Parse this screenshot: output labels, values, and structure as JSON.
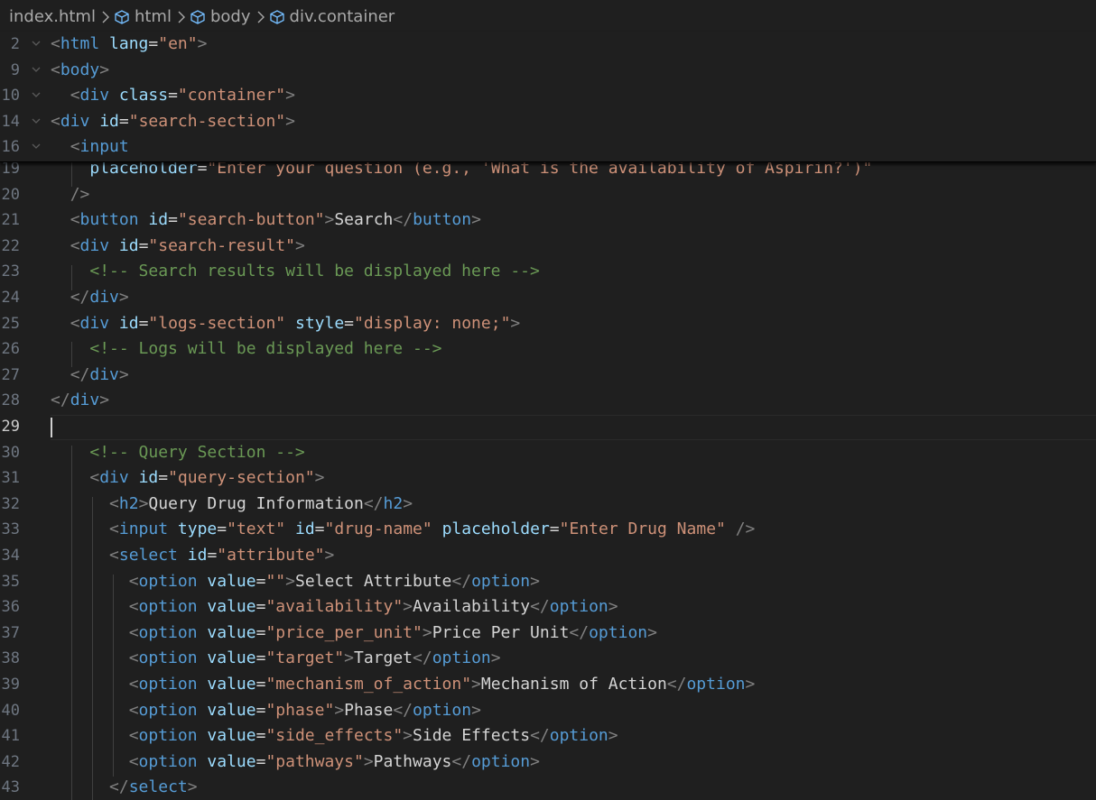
{
  "breadcrumb": {
    "file": "index.html",
    "items": [
      "html",
      "body",
      "div.container"
    ]
  },
  "sticky_lines": [
    {
      "num": "2",
      "parts": [
        [
          "tg",
          "<"
        ],
        [
          "tn",
          "html"
        ],
        [
          "tx",
          " "
        ],
        [
          "an",
          "lang"
        ],
        [
          "tx",
          "="
        ],
        [
          "av",
          "\"en\""
        ],
        [
          "tg",
          ">"
        ]
      ]
    },
    {
      "num": "9",
      "parts": [
        [
          "tg",
          "<"
        ],
        [
          "tn",
          "body"
        ],
        [
          "tg",
          ">"
        ]
      ]
    },
    {
      "num": "10",
      "parts": [
        [
          "tx",
          "  "
        ],
        [
          "tg",
          "<"
        ],
        [
          "tn",
          "div"
        ],
        [
          "tx",
          " "
        ],
        [
          "an",
          "class"
        ],
        [
          "tx",
          "="
        ],
        [
          "av",
          "\"container\""
        ],
        [
          "tg",
          ">"
        ]
      ]
    },
    {
      "num": "14",
      "parts": [
        [
          "tg",
          "<"
        ],
        [
          "tn",
          "div"
        ],
        [
          "tx",
          " "
        ],
        [
          "an",
          "id"
        ],
        [
          "tx",
          "="
        ],
        [
          "av",
          "\"search-section\""
        ],
        [
          "tg",
          ">"
        ]
      ]
    },
    {
      "num": "16",
      "parts": [
        [
          "tx",
          "  "
        ],
        [
          "tg",
          "<"
        ],
        [
          "tn",
          "input"
        ]
      ]
    }
  ],
  "lines": [
    {
      "num": "19",
      "parts": [
        [
          "tx",
          "    "
        ],
        [
          "an",
          "placeholder"
        ],
        [
          "tx",
          "="
        ],
        [
          "av",
          "\"Enter your question (e.g., 'What is the availability of Aspirin?')\""
        ]
      ]
    },
    {
      "num": "20",
      "parts": [
        [
          "tx",
          "  "
        ],
        [
          "tg",
          "/>"
        ]
      ]
    },
    {
      "num": "21",
      "parts": [
        [
          "tx",
          "  "
        ],
        [
          "tg",
          "<"
        ],
        [
          "tn",
          "button"
        ],
        [
          "tx",
          " "
        ],
        [
          "an",
          "id"
        ],
        [
          "tx",
          "="
        ],
        [
          "av",
          "\"search-button\""
        ],
        [
          "tg",
          ">"
        ],
        [
          "tx",
          "Search"
        ],
        [
          "tg",
          "</"
        ],
        [
          "tn",
          "button"
        ],
        [
          "tg",
          ">"
        ]
      ]
    },
    {
      "num": "22",
      "parts": [
        [
          "tx",
          "  "
        ],
        [
          "tg",
          "<"
        ],
        [
          "tn",
          "div"
        ],
        [
          "tx",
          " "
        ],
        [
          "an",
          "id"
        ],
        [
          "tx",
          "="
        ],
        [
          "av",
          "\"search-result\""
        ],
        [
          "tg",
          ">"
        ]
      ]
    },
    {
      "num": "23",
      "parts": [
        [
          "tx",
          "    "
        ],
        [
          "cm",
          "<!-- Search results will be displayed here -->"
        ]
      ]
    },
    {
      "num": "24",
      "parts": [
        [
          "tx",
          "  "
        ],
        [
          "tg",
          "</"
        ],
        [
          "tn",
          "div"
        ],
        [
          "tg",
          ">"
        ]
      ]
    },
    {
      "num": "25",
      "parts": [
        [
          "tx",
          "  "
        ],
        [
          "tg",
          "<"
        ],
        [
          "tn",
          "div"
        ],
        [
          "tx",
          " "
        ],
        [
          "an",
          "id"
        ],
        [
          "tx",
          "="
        ],
        [
          "av",
          "\"logs-section\""
        ],
        [
          "tx",
          " "
        ],
        [
          "an",
          "style"
        ],
        [
          "tx",
          "="
        ],
        [
          "av",
          "\"display: none;\""
        ],
        [
          "tg",
          ">"
        ]
      ]
    },
    {
      "num": "26",
      "parts": [
        [
          "tx",
          "    "
        ],
        [
          "cm",
          "<!-- Logs will be displayed here -->"
        ]
      ]
    },
    {
      "num": "27",
      "parts": [
        [
          "tx",
          "  "
        ],
        [
          "tg",
          "</"
        ],
        [
          "tn",
          "div"
        ],
        [
          "tg",
          ">"
        ]
      ]
    },
    {
      "num": "28",
      "parts": [
        [
          "tg",
          "</"
        ],
        [
          "tn",
          "div"
        ],
        [
          "tg",
          ">"
        ]
      ]
    },
    {
      "num": "29",
      "parts": []
    },
    {
      "num": "30",
      "parts": [
        [
          "tx",
          "    "
        ],
        [
          "cm",
          "<!-- Query Section -->"
        ]
      ]
    },
    {
      "num": "31",
      "parts": [
        [
          "tx",
          "    "
        ],
        [
          "tg",
          "<"
        ],
        [
          "tn",
          "div"
        ],
        [
          "tx",
          " "
        ],
        [
          "an",
          "id"
        ],
        [
          "tx",
          "="
        ],
        [
          "av",
          "\"query-section\""
        ],
        [
          "tg",
          ">"
        ]
      ]
    },
    {
      "num": "32",
      "parts": [
        [
          "tx",
          "      "
        ],
        [
          "tg",
          "<"
        ],
        [
          "tn",
          "h2"
        ],
        [
          "tg",
          ">"
        ],
        [
          "tx",
          "Query Drug Information"
        ],
        [
          "tg",
          "</"
        ],
        [
          "tn",
          "h2"
        ],
        [
          "tg",
          ">"
        ]
      ]
    },
    {
      "num": "33",
      "parts": [
        [
          "tx",
          "      "
        ],
        [
          "tg",
          "<"
        ],
        [
          "tn",
          "input"
        ],
        [
          "tx",
          " "
        ],
        [
          "an",
          "type"
        ],
        [
          "tx",
          "="
        ],
        [
          "av",
          "\"text\""
        ],
        [
          "tx",
          " "
        ],
        [
          "an",
          "id"
        ],
        [
          "tx",
          "="
        ],
        [
          "av",
          "\"drug-name\""
        ],
        [
          "tx",
          " "
        ],
        [
          "an",
          "placeholder"
        ],
        [
          "tx",
          "="
        ],
        [
          "av",
          "\"Enter Drug Name\""
        ],
        [
          "tx",
          " "
        ],
        [
          "tg",
          "/>"
        ]
      ]
    },
    {
      "num": "34",
      "parts": [
        [
          "tx",
          "      "
        ],
        [
          "tg",
          "<"
        ],
        [
          "tn",
          "select"
        ],
        [
          "tx",
          " "
        ],
        [
          "an",
          "id"
        ],
        [
          "tx",
          "="
        ],
        [
          "av",
          "\"attribute\""
        ],
        [
          "tg",
          ">"
        ]
      ]
    },
    {
      "num": "35",
      "parts": [
        [
          "tx",
          "        "
        ],
        [
          "tg",
          "<"
        ],
        [
          "tn",
          "option"
        ],
        [
          "tx",
          " "
        ],
        [
          "an",
          "value"
        ],
        [
          "tx",
          "="
        ],
        [
          "av",
          "\"\""
        ],
        [
          "tg",
          ">"
        ],
        [
          "tx",
          "Select Attribute"
        ],
        [
          "tg",
          "</"
        ],
        [
          "tn",
          "option"
        ],
        [
          "tg",
          ">"
        ]
      ]
    },
    {
      "num": "36",
      "parts": [
        [
          "tx",
          "        "
        ],
        [
          "tg",
          "<"
        ],
        [
          "tn",
          "option"
        ],
        [
          "tx",
          " "
        ],
        [
          "an",
          "value"
        ],
        [
          "tx",
          "="
        ],
        [
          "av",
          "\"availability\""
        ],
        [
          "tg",
          ">"
        ],
        [
          "tx",
          "Availability"
        ],
        [
          "tg",
          "</"
        ],
        [
          "tn",
          "option"
        ],
        [
          "tg",
          ">"
        ]
      ]
    },
    {
      "num": "37",
      "parts": [
        [
          "tx",
          "        "
        ],
        [
          "tg",
          "<"
        ],
        [
          "tn",
          "option"
        ],
        [
          "tx",
          " "
        ],
        [
          "an",
          "value"
        ],
        [
          "tx",
          "="
        ],
        [
          "av",
          "\"price_per_unit\""
        ],
        [
          "tg",
          ">"
        ],
        [
          "tx",
          "Price Per Unit"
        ],
        [
          "tg",
          "</"
        ],
        [
          "tn",
          "option"
        ],
        [
          "tg",
          ">"
        ]
      ]
    },
    {
      "num": "38",
      "parts": [
        [
          "tx",
          "        "
        ],
        [
          "tg",
          "<"
        ],
        [
          "tn",
          "option"
        ],
        [
          "tx",
          " "
        ],
        [
          "an",
          "value"
        ],
        [
          "tx",
          "="
        ],
        [
          "av",
          "\"target\""
        ],
        [
          "tg",
          ">"
        ],
        [
          "tx",
          "Target"
        ],
        [
          "tg",
          "</"
        ],
        [
          "tn",
          "option"
        ],
        [
          "tg",
          ">"
        ]
      ]
    },
    {
      "num": "39",
      "parts": [
        [
          "tx",
          "        "
        ],
        [
          "tg",
          "<"
        ],
        [
          "tn",
          "option"
        ],
        [
          "tx",
          " "
        ],
        [
          "an",
          "value"
        ],
        [
          "tx",
          "="
        ],
        [
          "av",
          "\"mechanism_of_action\""
        ],
        [
          "tg",
          ">"
        ],
        [
          "tx",
          "Mechanism of Action"
        ],
        [
          "tg",
          "</"
        ],
        [
          "tn",
          "option"
        ],
        [
          "tg",
          ">"
        ]
      ]
    },
    {
      "num": "40",
      "parts": [
        [
          "tx",
          "        "
        ],
        [
          "tg",
          "<"
        ],
        [
          "tn",
          "option"
        ],
        [
          "tx",
          " "
        ],
        [
          "an",
          "value"
        ],
        [
          "tx",
          "="
        ],
        [
          "av",
          "\"phase\""
        ],
        [
          "tg",
          ">"
        ],
        [
          "tx",
          "Phase"
        ],
        [
          "tg",
          "</"
        ],
        [
          "tn",
          "option"
        ],
        [
          "tg",
          ">"
        ]
      ]
    },
    {
      "num": "41",
      "parts": [
        [
          "tx",
          "        "
        ],
        [
          "tg",
          "<"
        ],
        [
          "tn",
          "option"
        ],
        [
          "tx",
          " "
        ],
        [
          "an",
          "value"
        ],
        [
          "tx",
          "="
        ],
        [
          "av",
          "\"side_effects\""
        ],
        [
          "tg",
          ">"
        ],
        [
          "tx",
          "Side Effects"
        ],
        [
          "tg",
          "</"
        ],
        [
          "tn",
          "option"
        ],
        [
          "tg",
          ">"
        ]
      ]
    },
    {
      "num": "42",
      "parts": [
        [
          "tx",
          "        "
        ],
        [
          "tg",
          "<"
        ],
        [
          "tn",
          "option"
        ],
        [
          "tx",
          " "
        ],
        [
          "an",
          "value"
        ],
        [
          "tx",
          "="
        ],
        [
          "av",
          "\"pathways\""
        ],
        [
          "tg",
          ">"
        ],
        [
          "tx",
          "Pathways"
        ],
        [
          "tg",
          "</"
        ],
        [
          "tn",
          "option"
        ],
        [
          "tg",
          ">"
        ]
      ]
    },
    {
      "num": "43",
      "parts": [
        [
          "tx",
          "      "
        ],
        [
          "tg",
          "</"
        ],
        [
          "tn",
          "select"
        ],
        [
          "tg",
          ">"
        ]
      ]
    }
  ],
  "active_line": "29"
}
